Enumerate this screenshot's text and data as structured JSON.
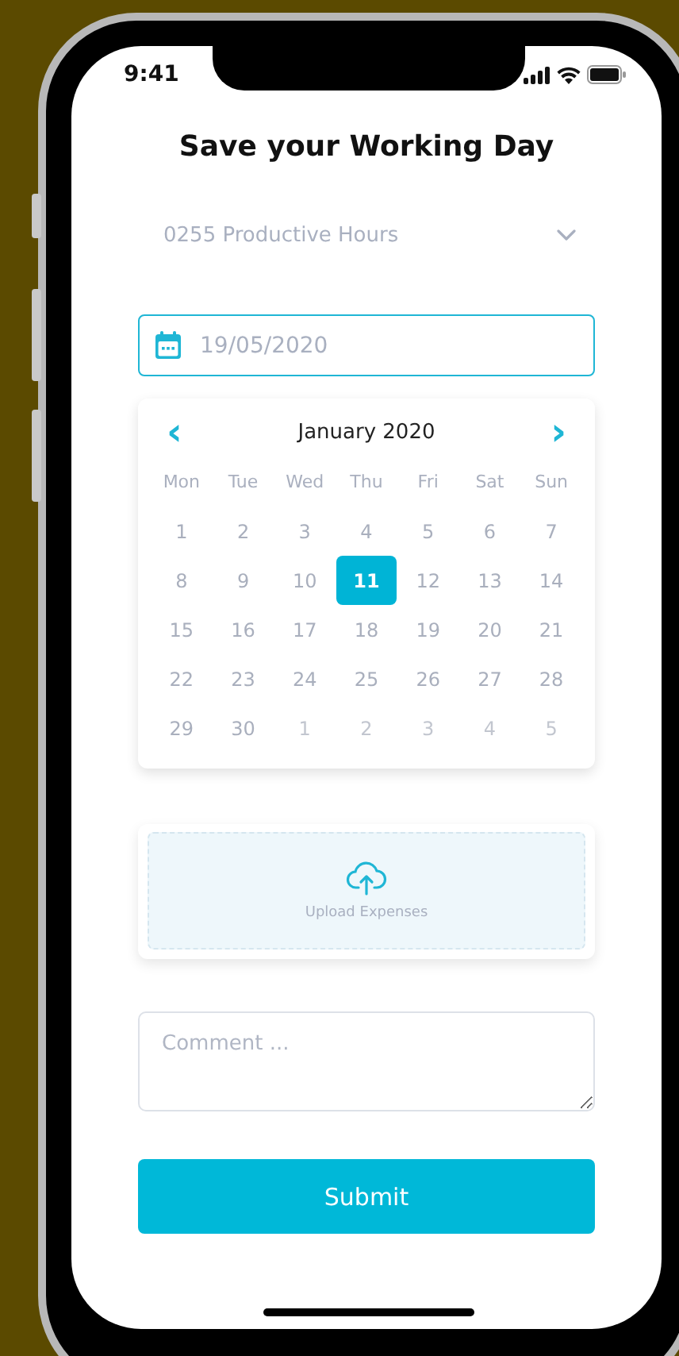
{
  "status_bar": {
    "time": "9:41"
  },
  "title": "Save your Working Day",
  "hours_dropdown": {
    "value": "0255 Productive Hours"
  },
  "date_field": {
    "value": "19/05/2020"
  },
  "calendar": {
    "prev": "‹",
    "next": "›",
    "month": "January 2020",
    "weekdays": [
      "Mon",
      "Tue",
      "Wed",
      "Thu",
      "Fri",
      "Sat",
      "Sun"
    ],
    "weeks": [
      [
        {
          "day": "1",
          "kind": "current",
          "selected": false
        },
        {
          "day": "2",
          "kind": "current",
          "selected": false
        },
        {
          "day": "3",
          "kind": "current",
          "selected": false
        },
        {
          "day": "4",
          "kind": "current",
          "selected": false
        },
        {
          "day": "5",
          "kind": "current",
          "selected": false
        },
        {
          "day": "6",
          "kind": "current",
          "selected": false
        },
        {
          "day": "7",
          "kind": "current",
          "selected": false
        }
      ],
      [
        {
          "day": "8",
          "kind": "current",
          "selected": false
        },
        {
          "day": "9",
          "kind": "current",
          "selected": false
        },
        {
          "day": "10",
          "kind": "current",
          "selected": false
        },
        {
          "day": "11",
          "kind": "current",
          "selected": true
        },
        {
          "day": "12",
          "kind": "current",
          "selected": false
        },
        {
          "day": "13",
          "kind": "current",
          "selected": false
        },
        {
          "day": "14",
          "kind": "current",
          "selected": false
        }
      ],
      [
        {
          "day": "15",
          "kind": "current",
          "selected": false
        },
        {
          "day": "16",
          "kind": "current",
          "selected": false
        },
        {
          "day": "17",
          "kind": "current",
          "selected": false
        },
        {
          "day": "18",
          "kind": "current",
          "selected": false
        },
        {
          "day": "19",
          "kind": "current",
          "selected": false
        },
        {
          "day": "20",
          "kind": "current",
          "selected": false
        },
        {
          "day": "21",
          "kind": "current",
          "selected": false
        }
      ],
      [
        {
          "day": "22",
          "kind": "current",
          "selected": false
        },
        {
          "day": "23",
          "kind": "current",
          "selected": false
        },
        {
          "day": "24",
          "kind": "current",
          "selected": false
        },
        {
          "day": "25",
          "kind": "current",
          "selected": false
        },
        {
          "day": "26",
          "kind": "current",
          "selected": false
        },
        {
          "day": "27",
          "kind": "current",
          "selected": false
        },
        {
          "day": "28",
          "kind": "current",
          "selected": false
        }
      ],
      [
        {
          "day": "29",
          "kind": "current",
          "selected": false
        },
        {
          "day": "30",
          "kind": "current",
          "selected": false
        },
        {
          "day": "1",
          "kind": "other",
          "selected": false
        },
        {
          "day": "2",
          "kind": "other",
          "selected": false
        },
        {
          "day": "3",
          "kind": "other",
          "selected": false
        },
        {
          "day": "4",
          "kind": "other",
          "selected": false
        },
        {
          "day": "5",
          "kind": "other",
          "selected": false
        }
      ]
    ]
  },
  "upload": {
    "label": "Upload Expenses"
  },
  "comment": {
    "placeholder": "Comment ..."
  },
  "submit": {
    "label": "Submit"
  }
}
